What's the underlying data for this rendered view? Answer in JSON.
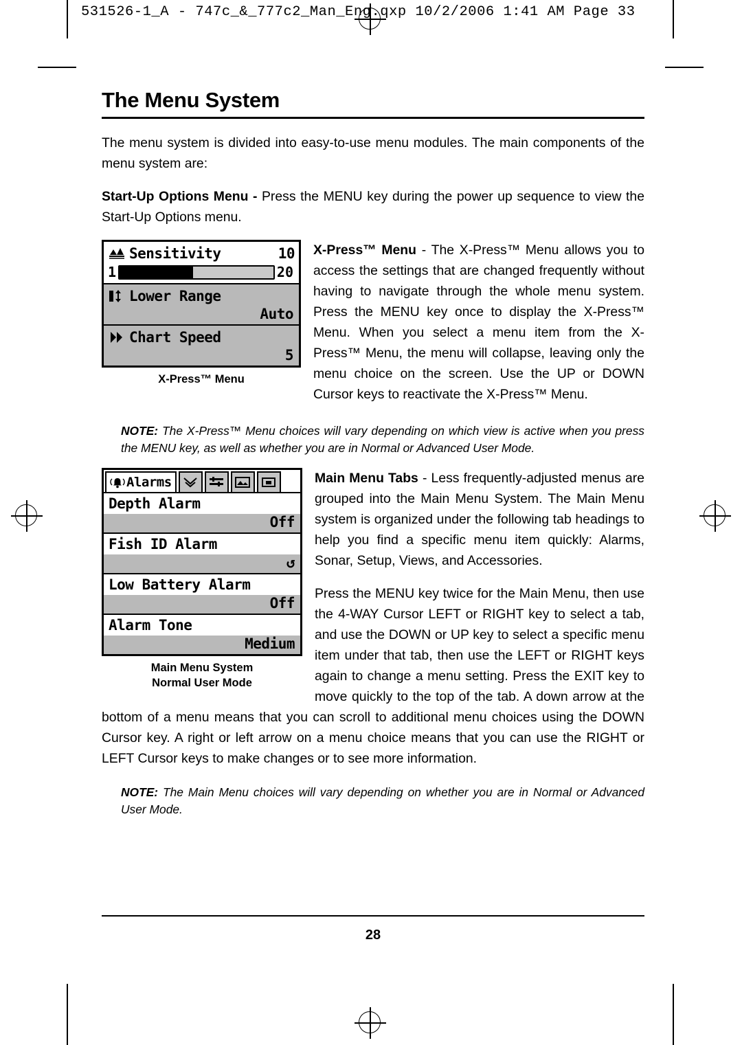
{
  "header": {
    "slug": "531526-1_A - 747c_&_777c2_Man_Eng.qxp   10/2/2006  1:41 AM  Page 33"
  },
  "page": {
    "title": "The Menu System",
    "intro": "The menu system is divided into easy-to-use menu modules. The main components of the menu system are:",
    "startup_bold": "Start-Up Options Menu - ",
    "startup_text": "Press the MENU key during the power up sequence to view the Start-Up Options menu.",
    "xpress_bold": "X-Press™ Menu",
    "xpress_text": " - The X-Press™ Menu allows you to access the settings that are changed frequently without having to navigate through the whole menu system. Press the MENU key once to display the X-Press™ Menu. When you select a menu item from the X-Press™ Menu, the menu will collapse, leaving only the menu choice on the screen. Use the UP or DOWN Cursor keys to reactivate the X-Press™ Menu.",
    "note1_label": "NOTE:",
    "note1_text": " The X-Press™ Menu choices will vary depending on which view is active when you press the MENU key, as well as whether you are in Normal or Advanced User Mode.",
    "maintabs_bold": "Main Menu Tabs",
    "maintabs_text": " - Less frequently-adjusted menus are grouped into the Main Menu System. The Main Menu system is organized under the following tab headings to help you find a specific menu item quickly: Alarms, Sonar, Setup, Views, and Accessories.",
    "press_text": "Press the MENU key twice for the Main Menu, then use the 4-WAY Cursor LEFT or RIGHT key to select a tab, and use the DOWN or UP key to select a specific menu item under that tab, then use the LEFT or RIGHT keys again to change a menu setting. Press the EXIT key to move quickly to the top of the tab. A down arrow at the bottom of a menu means that you can scroll to additional menu choices using the DOWN Cursor key. A right or left arrow on a menu choice means that you can use the RIGHT or LEFT Cursor keys to make changes or to see more information.",
    "note2_label": "NOTE:",
    "note2_text": " The Main Menu choices will vary depending on whether you are in Normal or Advanced User Mode.",
    "folio": "28"
  },
  "xpress_figure": {
    "caption": "X-Press™ Menu",
    "rows": [
      {
        "label": "Sensitivity",
        "value": "10",
        "icon": "sensitivity-icon"
      },
      {
        "label": "Lower Range",
        "value": "Auto",
        "icon": "lower-range-icon"
      },
      {
        "label": "Chart Speed",
        "value": "5",
        "icon": "chart-speed-icon"
      }
    ],
    "slider": {
      "min": "1",
      "max": "20",
      "fill_percent": 48
    }
  },
  "mainmenu_figure": {
    "caption_line1": "Main Menu System",
    "caption_line2": "Normal User Mode",
    "active_tab": "Alarms",
    "tab_icons": [
      "sonar-tab-icon",
      "setup-tab-icon",
      "views-tab-icon",
      "accessories-tab-icon"
    ],
    "rows": [
      {
        "label": "Depth Alarm",
        "value": "Off"
      },
      {
        "label": "Fish ID Alarm",
        "value": "↺"
      },
      {
        "label": "Low Battery Alarm",
        "value": "Off"
      },
      {
        "label": "Alarm Tone",
        "value": "Medium"
      }
    ]
  }
}
